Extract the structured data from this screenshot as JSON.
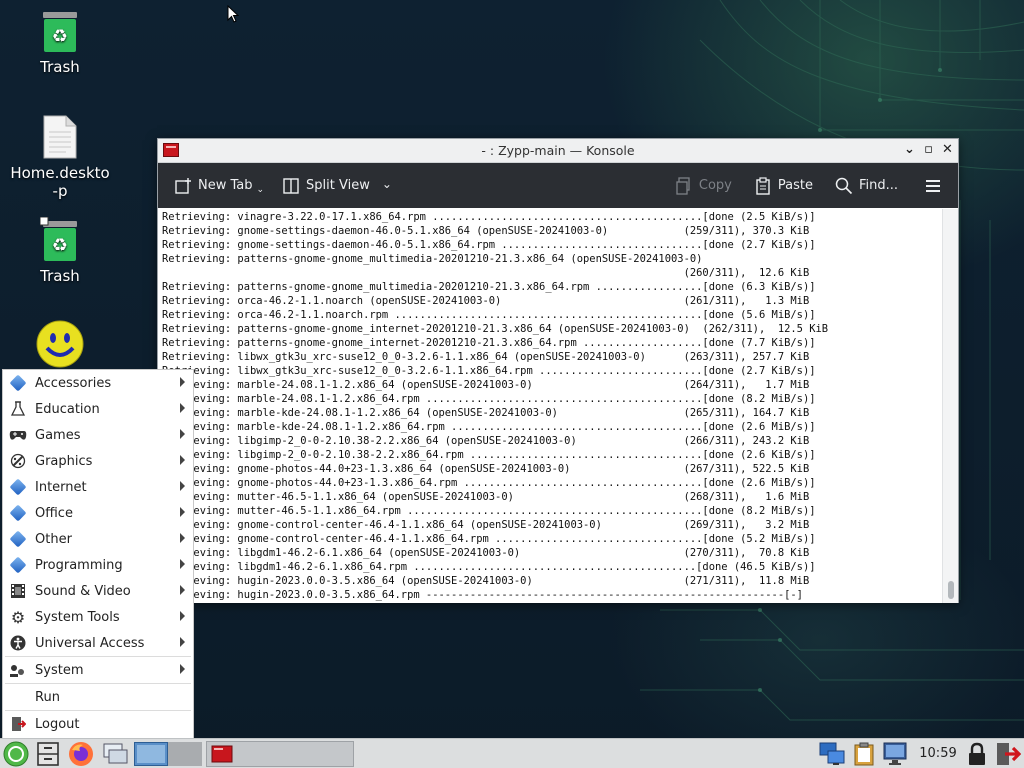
{
  "desktop": {
    "icons": [
      {
        "label": "Trash"
      },
      {
        "label": "Home.deskto-p"
      },
      {
        "label": "Trash"
      },
      {
        "label": ""
      }
    ]
  },
  "konsole": {
    "title": "- : Zypp-main — Konsole",
    "toolbar": {
      "new_tab": "New Tab",
      "split_view": "Split View",
      "copy": "Copy",
      "paste": "Paste",
      "find": "Find..."
    },
    "lines": [
      "Retrieving: vinagre-3.22.0-17.1.x86_64.rpm ...........................................[done (2.5 KiB/s)]",
      "Retrieving: gnome-settings-daemon-46.0-5.1.x86_64 (openSUSE-20241003-0)            (259/311), 370.3 KiB",
      "Retrieving: gnome-settings-daemon-46.0-5.1.x86_64.rpm ................................[done (2.7 KiB/s)]",
      "Retrieving: patterns-gnome-gnome_multimedia-20201210-21.3.x86_64 (openSUSE-20241003-0)",
      "                                                                                   (260/311),  12.6 KiB",
      "Retrieving: patterns-gnome-gnome_multimedia-20201210-21.3.x86_64.rpm .................[done (6.3 KiB/s)]",
      "Retrieving: orca-46.2-1.1.noarch (openSUSE-20241003-0)                             (261/311),   1.3 MiB",
      "Retrieving: orca-46.2-1.1.noarch.rpm .................................................[done (5.6 MiB/s)]",
      "Retrieving: patterns-gnome-gnome_internet-20201210-21.3.x86_64 (openSUSE-20241003-0)  (262/311),  12.5 KiB",
      "Retrieving: patterns-gnome-gnome_internet-20201210-21.3.x86_64.rpm ...................[done (7.7 KiB/s)]",
      "Retrieving: libwx_gtk3u_xrc-suse12_0_0-3.2.6-1.1.x86_64 (openSUSE-20241003-0)      (263/311), 257.7 KiB",
      "Retrieving: libwx_gtk3u_xrc-suse12_0_0-3.2.6-1.1.x86_64.rpm ..........................[done (2.7 KiB/s)]",
      "Retrieving: marble-24.08.1-1.2.x86_64 (openSUSE-20241003-0)                        (264/311),   1.7 MiB",
      "Retrieving: marble-24.08.1-1.2.x86_64.rpm ............................................[done (8.2 MiB/s)]",
      "Retrieving: marble-kde-24.08.1-1.2.x86_64 (openSUSE-20241003-0)                    (265/311), 164.7 KiB",
      "Retrieving: marble-kde-24.08.1-1.2.x86_64.rpm ........................................[done (2.6 MiB/s)]",
      "Retrieving: libgimp-2_0-0-2.10.38-2.2.x86_64 (openSUSE-20241003-0)                 (266/311), 243.2 KiB",
      "Retrieving: libgimp-2_0-0-2.10.38-2.2.x86_64.rpm .....................................[done (2.6 KiB/s)]",
      "Retrieving: gnome-photos-44.0+23-1.3.x86_64 (openSUSE-20241003-0)                  (267/311), 522.5 KiB",
      "Retrieving: gnome-photos-44.0+23-1.3.x86_64.rpm ......................................[done (2.6 MiB/s)]",
      "Retrieving: mutter-46.5-1.1.x86_64 (openSUSE-20241003-0)                           (268/311),   1.6 MiB",
      "Retrieving: mutter-46.5-1.1.x86_64.rpm ...............................................[done (8.2 MiB/s)]",
      "Retrieving: gnome-control-center-46.4-1.1.x86_64 (openSUSE-20241003-0)             (269/311),   3.2 MiB",
      "Retrieving: gnome-control-center-46.4-1.1.x86_64.rpm .................................[done (5.2 MiB/s)]",
      "Retrieving: libgdm1-46.2-6.1.x86_64 (openSUSE-20241003-0)                          (270/311),  70.8 KiB",
      "Retrieving: libgdm1-46.2-6.1.x86_64.rpm .............................................[done (46.5 KiB/s)]",
      "Retrieving: hugin-2023.0.0-3.5.x86_64 (openSUSE-20241003-0)                        (271/311),  11.8 MiB",
      "Retrieving: hugin-2023.0.0-3.5.x86_64.rpm ---------------------------------------------------------[-]"
    ]
  },
  "menu": {
    "items": [
      {
        "label": "Accessories",
        "icon": "accessories-icon"
      },
      {
        "label": "Education",
        "icon": "flask-icon"
      },
      {
        "label": "Games",
        "icon": "gamepad-icon"
      },
      {
        "label": "Graphics",
        "icon": "palette-icon"
      },
      {
        "label": "Internet",
        "icon": "diamond-icon"
      },
      {
        "label": "Office",
        "icon": "diamond-icon"
      },
      {
        "label": "Other",
        "icon": "diamond-icon"
      },
      {
        "label": "Programming",
        "icon": "diamond-icon"
      },
      {
        "label": "Sound & Video",
        "icon": "film-icon"
      },
      {
        "label": "System Tools",
        "icon": "gear-icon"
      },
      {
        "label": "Universal Access",
        "icon": "accessibility-icon"
      }
    ],
    "system": "System",
    "run": "Run",
    "logout": "Logout"
  },
  "taskbar": {
    "clock": "10:59"
  }
}
